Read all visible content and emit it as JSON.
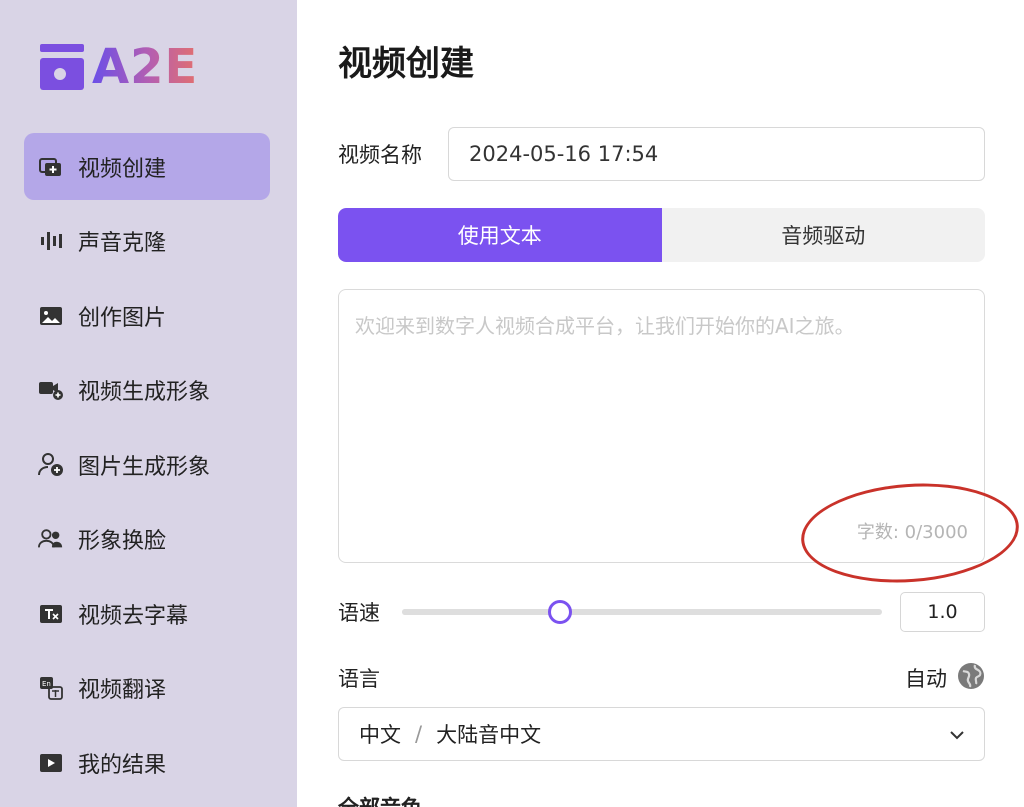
{
  "brand": {
    "logo_text": "A2E"
  },
  "sidebar": {
    "items": [
      {
        "label": "视频创建",
        "icon": "video-create-icon",
        "active": true
      },
      {
        "label": "声音克隆",
        "icon": "voice-wave-icon",
        "active": false
      },
      {
        "label": "创作图片",
        "icon": "image-icon",
        "active": false
      },
      {
        "label": "视频生成形象",
        "icon": "video-avatar-icon",
        "active": false
      },
      {
        "label": "图片生成形象",
        "icon": "person-add-icon",
        "active": false
      },
      {
        "label": "形象换脸",
        "icon": "face-swap-icon",
        "active": false
      },
      {
        "label": "视频去字幕",
        "icon": "subtitle-remove-icon",
        "active": false
      },
      {
        "label": "视频翻译",
        "icon": "translate-icon",
        "active": false
      },
      {
        "label": "我的结果",
        "icon": "play-results-icon",
        "active": false
      }
    ]
  },
  "main": {
    "title": "视频创建",
    "name_field": {
      "label": "视频名称",
      "value": "2024-05-16 17:54"
    },
    "tabs": [
      {
        "label": "使用文本",
        "active": true
      },
      {
        "label": "音频驱动",
        "active": false
      }
    ],
    "text_input": {
      "placeholder": "欢迎来到数字人视频合成平台，让我们开始你的AI之旅。",
      "char_count": "字数: 0/3000"
    },
    "speed": {
      "label": "语速",
      "value": "1.0",
      "fraction": 0.33
    },
    "language": {
      "label": "语言",
      "auto_label": "自动",
      "selected_language": "中文",
      "separator": "/",
      "selected_accent": "大陆音中文"
    },
    "voice_section_label": "全部音色"
  },
  "colors": {
    "accent": "#7b52f0",
    "sidebar_bg": "#d9d4e6",
    "active_item_bg": "#b4a7e8",
    "annotation": "#c9322a"
  }
}
